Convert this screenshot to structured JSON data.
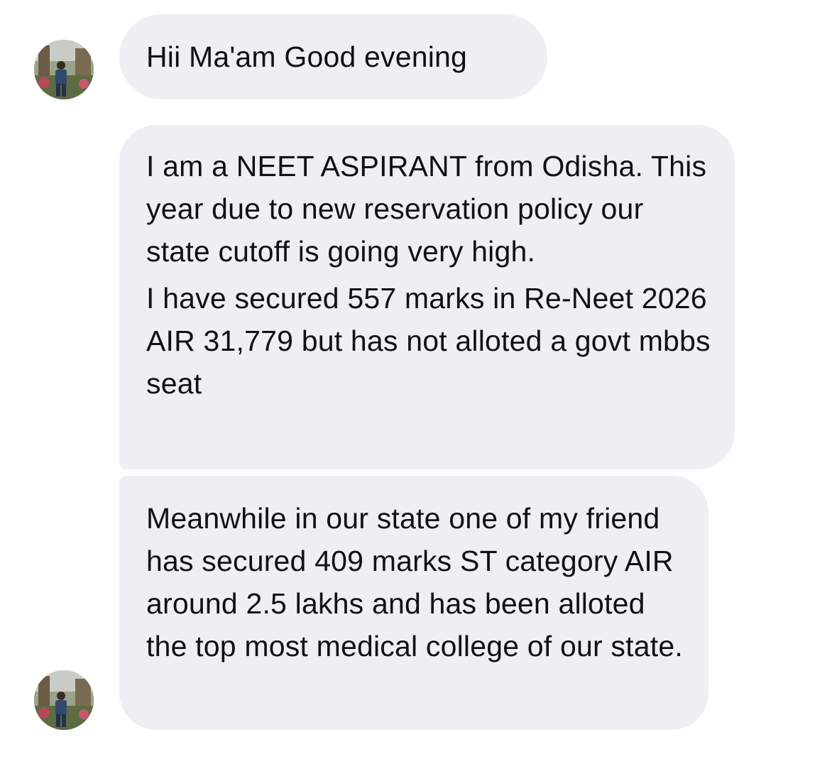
{
  "thread": {
    "sender_avatar_icon": "user-avatar-icon",
    "bubble_color": "#eeeff3",
    "messages": [
      {
        "paragraphs": [
          "Hii Ma'am Good evening"
        ]
      },
      {
        "paragraphs": [
          "I am a NEET ASPIRANT from Odisha. This year due to new reservation policy our state cutoff is going very high.",
          "I have secured 557 marks in Re-Neet 2026 AIR 31,779 but has not alloted a govt mbbs seat"
        ]
      },
      {
        "paragraphs": [
          "Meanwhile in our state one of my friend has secured 409 marks ST category AIR around 2.5 lakhs and has been alloted the top most medical college of our state."
        ]
      }
    ]
  }
}
